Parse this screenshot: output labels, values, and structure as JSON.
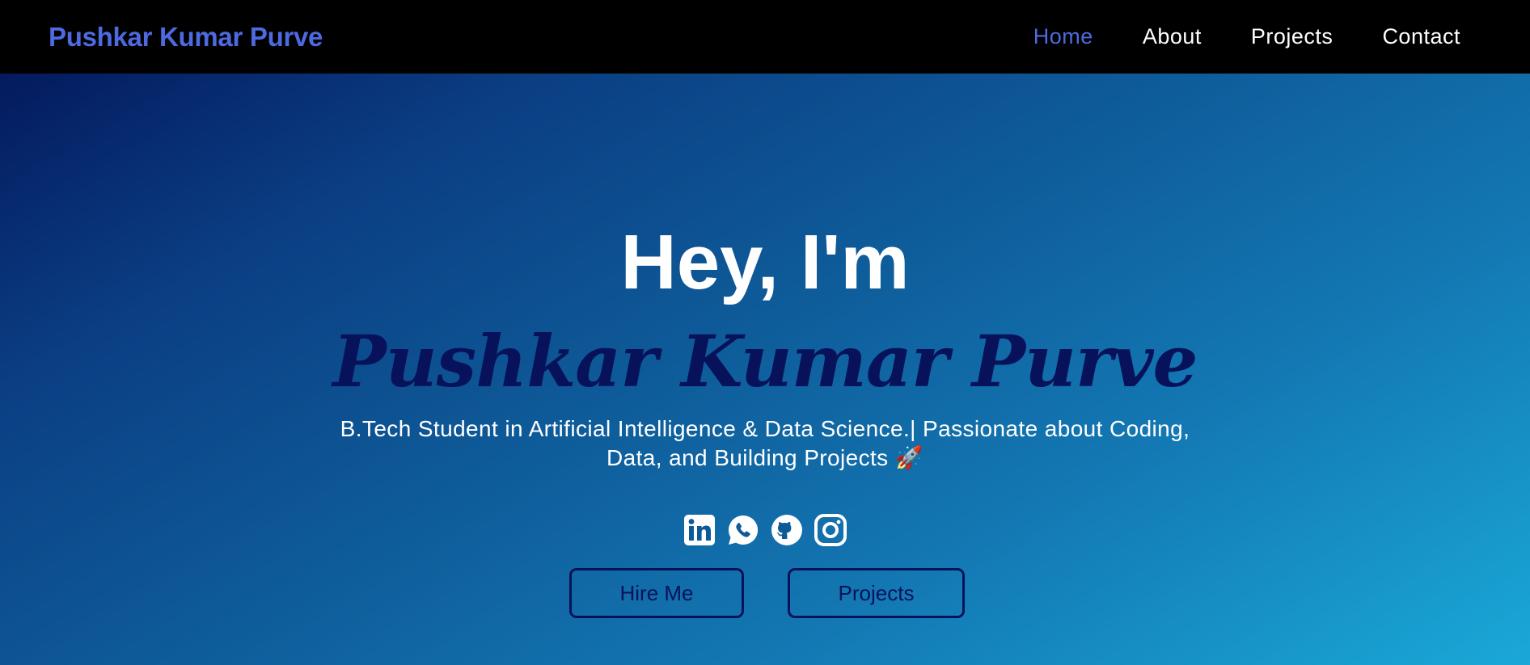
{
  "navbar": {
    "brand": "Pushkar Kumar Purve",
    "links": [
      {
        "label": "Home",
        "active": true
      },
      {
        "label": "About",
        "active": false
      },
      {
        "label": "Projects",
        "active": false
      },
      {
        "label": "Contact",
        "active": false
      }
    ]
  },
  "hero": {
    "greeting": "Hey, I'm",
    "name": "Pushkar Kumar Purve",
    "tagline": "B.Tech Student in Artificial Intelligence & Data Science.| Passionate about Coding, Data, and Building Projects 🚀",
    "socials": [
      {
        "icon": "linkedin-icon"
      },
      {
        "icon": "whatsapp-icon"
      },
      {
        "icon": "github-icon"
      },
      {
        "icon": "instagram-icon"
      }
    ],
    "buttons": {
      "hire": "Hire Me",
      "projects": "Projects"
    }
  },
  "colors": {
    "nav_bg": "#000000",
    "accent": "#4d6ae0",
    "name_color": "#07125a",
    "gradient_start": "#041a5e",
    "gradient_end": "#1aa8d8"
  }
}
